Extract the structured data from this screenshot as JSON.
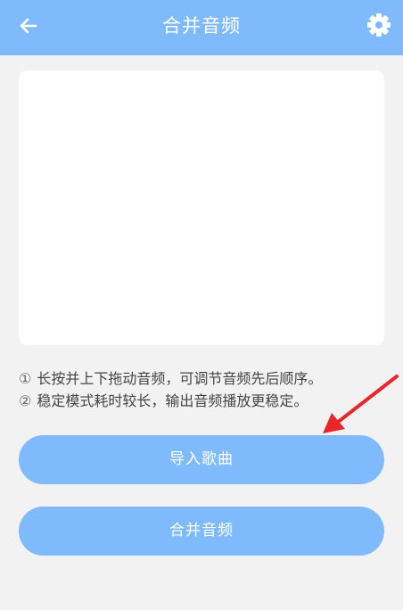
{
  "header": {
    "title": "合并音频",
    "back_icon": "arrow-left-icon",
    "settings_icon": "gear-icon",
    "background": "#7fbafd"
  },
  "tips": [
    {
      "num": "①",
      "text": "长按并上下拖动音频，可调节音频先后顺序。"
    },
    {
      "num": "②",
      "text": "稳定模式耗时较长，输出音频播放更稳定。"
    }
  ],
  "buttons": {
    "import_label": "导入歌曲",
    "merge_label": "合并音频"
  },
  "colors": {
    "accent": "#7fbafd",
    "page_background": "#f2f2f2",
    "annotation_arrow": "#e8262b"
  }
}
